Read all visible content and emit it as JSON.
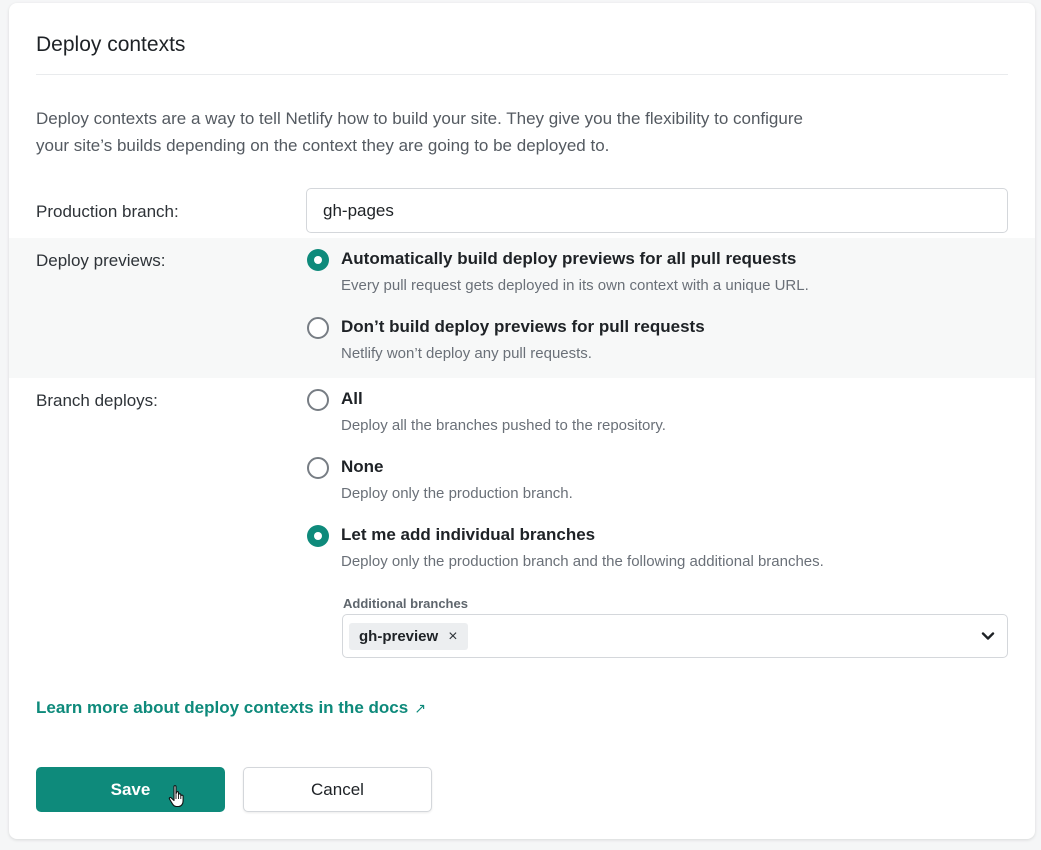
{
  "section": {
    "title": "Deploy contexts",
    "intro": "Deploy contexts are a way to tell Netlify how to build your site. They give you the flexibility to configure your site’s builds depending on the context they are going to be deployed to."
  },
  "production_branch": {
    "label": "Production branch:",
    "value": "gh-pages"
  },
  "deploy_previews": {
    "label": "Deploy previews:",
    "options": [
      {
        "label": "Automatically build deploy previews for all pull requests",
        "description": "Every pull request gets deployed in its own context with a unique URL.",
        "checked": true
      },
      {
        "label": "Don’t build deploy previews for pull requests",
        "description": "Netlify won’t deploy any pull requests.",
        "checked": false
      }
    ]
  },
  "branch_deploys": {
    "label": "Branch deploys:",
    "options": [
      {
        "label": "All",
        "description": "Deploy all the branches pushed to the repository.",
        "checked": false
      },
      {
        "label": "None",
        "description": "Deploy only the production branch.",
        "checked": false
      },
      {
        "label": "Let me add individual branches",
        "description": "Deploy only the production branch and the following additional branches.",
        "checked": true
      }
    ],
    "additional_branches": {
      "label": "Additional branches",
      "selected": [
        "gh-preview"
      ],
      "remove_glyph": "×"
    }
  },
  "docs_link": {
    "label": "Learn more about deploy contexts in the docs",
    "arrow": "↗"
  },
  "actions": {
    "save_label": "Save",
    "cancel_label": "Cancel"
  },
  "colors": {
    "accent": "#0e8a7b",
    "shaded_row": "#f7f8f8"
  }
}
